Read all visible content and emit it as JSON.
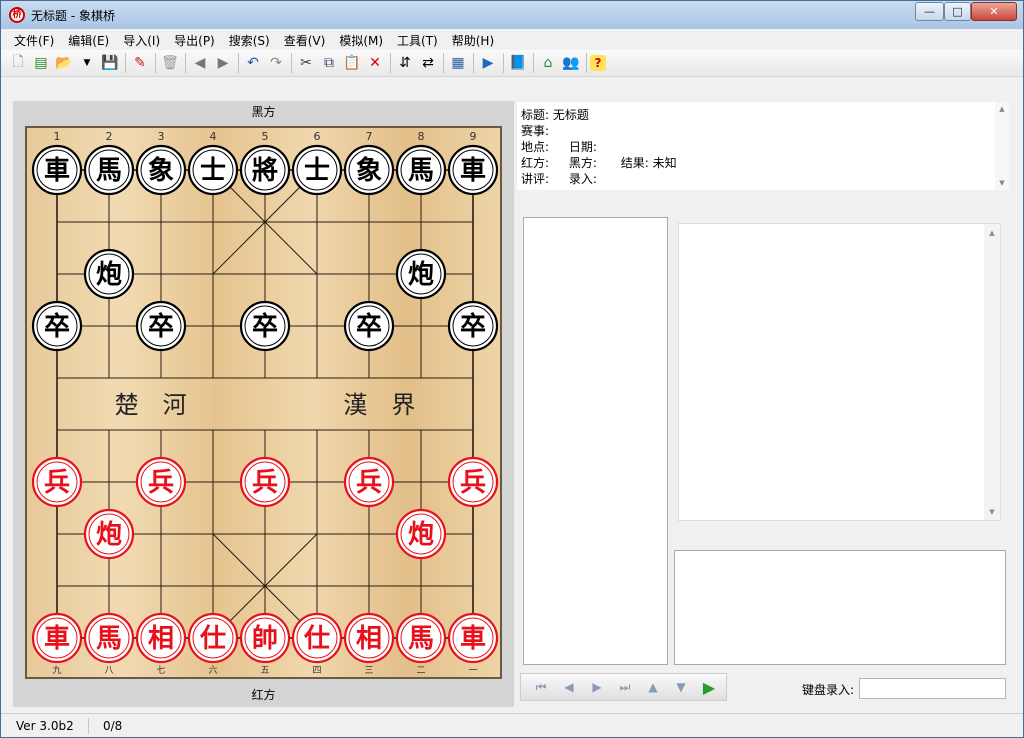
{
  "window": {
    "title": "无标题 - 象棋桥",
    "app_icon_text": "桥",
    "min": "—",
    "max": "□",
    "close": "✕"
  },
  "menu": [
    "文件(F)",
    "编辑(E)",
    "导入(I)",
    "导出(P)",
    "搜索(S)",
    "查看(V)",
    "模拟(M)",
    "工具(T)",
    "帮助(H)"
  ],
  "toolbar": [
    "new-icon",
    "list-icon",
    "open-icon",
    "dropdown-icon",
    "save-icon",
    "edit-icon",
    "delete-icon",
    "back-icon",
    "forward-icon",
    "undo-icon",
    "redo-icon",
    "cut-icon",
    "copy-icon",
    "paste-icon",
    "remove-icon",
    "flip-vertical-icon",
    "flip-horizontal-icon",
    "table-icon",
    "play-icon",
    "book-icon",
    "home-icon",
    "users-icon",
    "help-icon"
  ],
  "board": {
    "top_label": "黑方",
    "bottom_label": "红方",
    "top_numbers": [
      "1",
      "2",
      "3",
      "4",
      "5",
      "6",
      "7",
      "8",
      "9"
    ],
    "bottom_numbers": [
      "九",
      "八",
      "七",
      "六",
      "五",
      "四",
      "三",
      "二",
      "一"
    ],
    "river_left": "楚　河",
    "river_right": "漢　界",
    "colors": {
      "red": "#e8101a",
      "black": "#000000",
      "line": "#2a1d10"
    },
    "pieces": [
      {
        "label": "車",
        "side": "black",
        "file": 1,
        "rank": 1
      },
      {
        "label": "馬",
        "side": "black",
        "file": 2,
        "rank": 1
      },
      {
        "label": "象",
        "side": "black",
        "file": 3,
        "rank": 1
      },
      {
        "label": "士",
        "side": "black",
        "file": 4,
        "rank": 1
      },
      {
        "label": "將",
        "side": "black",
        "file": 5,
        "rank": 1
      },
      {
        "label": "士",
        "side": "black",
        "file": 6,
        "rank": 1
      },
      {
        "label": "象",
        "side": "black",
        "file": 7,
        "rank": 1
      },
      {
        "label": "馬",
        "side": "black",
        "file": 8,
        "rank": 1
      },
      {
        "label": "車",
        "side": "black",
        "file": 9,
        "rank": 1
      },
      {
        "label": "炮",
        "side": "black",
        "file": 2,
        "rank": 3
      },
      {
        "label": "炮",
        "side": "black",
        "file": 8,
        "rank": 3
      },
      {
        "label": "卒",
        "side": "black",
        "file": 1,
        "rank": 4
      },
      {
        "label": "卒",
        "side": "black",
        "file": 3,
        "rank": 4
      },
      {
        "label": "卒",
        "side": "black",
        "file": 5,
        "rank": 4
      },
      {
        "label": "卒",
        "side": "black",
        "file": 7,
        "rank": 4
      },
      {
        "label": "卒",
        "side": "black",
        "file": 9,
        "rank": 4
      },
      {
        "label": "兵",
        "side": "red",
        "file": 1,
        "rank": 7
      },
      {
        "label": "兵",
        "side": "red",
        "file": 3,
        "rank": 7
      },
      {
        "label": "兵",
        "side": "red",
        "file": 5,
        "rank": 7
      },
      {
        "label": "兵",
        "side": "red",
        "file": 7,
        "rank": 7
      },
      {
        "label": "兵",
        "side": "red",
        "file": 9,
        "rank": 7
      },
      {
        "label": "炮",
        "side": "red",
        "file": 2,
        "rank": 8
      },
      {
        "label": "炮",
        "side": "red",
        "file": 8,
        "rank": 8
      },
      {
        "label": "車",
        "side": "red",
        "file": 1,
        "rank": 10
      },
      {
        "label": "馬",
        "side": "red",
        "file": 2,
        "rank": 10
      },
      {
        "label": "相",
        "side": "red",
        "file": 3,
        "rank": 10
      },
      {
        "label": "仕",
        "side": "red",
        "file": 4,
        "rank": 10
      },
      {
        "label": "帥",
        "side": "red",
        "file": 5,
        "rank": 10
      },
      {
        "label": "仕",
        "side": "red",
        "file": 6,
        "rank": 10
      },
      {
        "label": "相",
        "side": "red",
        "file": 7,
        "rank": 10
      },
      {
        "label": "馬",
        "side": "red",
        "file": 8,
        "rank": 10
      },
      {
        "label": "車",
        "side": "red",
        "file": 9,
        "rank": 10
      }
    ]
  },
  "info": {
    "title_label": "标题:",
    "title_value": "无标题",
    "event_label": "赛事:",
    "site_label": "地点:",
    "date_label": "日期:",
    "red_label": "红方:",
    "black_label": "黑方:",
    "result_label": "结果:",
    "result_value": "未知",
    "commentary_label": "讲评:",
    "recorder_label": "录入:"
  },
  "nav": {
    "first": "⏮",
    "prev": "◀",
    "next": "▶",
    "last": "⏭",
    "up": "▲",
    "down": "▼",
    "play": "▶"
  },
  "keyboard_label": "键盘录入:",
  "status": {
    "version": "Ver 3.0b2",
    "count": "0/8"
  }
}
